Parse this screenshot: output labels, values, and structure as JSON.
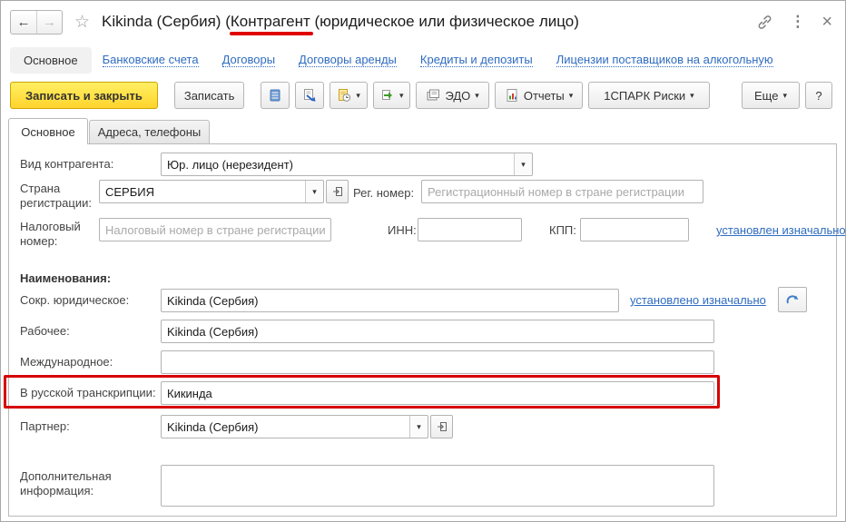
{
  "window": {
    "title_pre": "Kikinda (Сербия) (",
    "title_highlight": "Контрагент",
    "title_post": " (юридическое или физическое лицо)"
  },
  "icons": {
    "back": "←",
    "forward": "→",
    "star": "☆",
    "more_vert": "⋮",
    "close": "×",
    "caret": "▾",
    "help": "?"
  },
  "nav": {
    "active": "Основное",
    "links": [
      "Банковские счета",
      "Договоры",
      "Договоры аренды",
      "Кредиты и депозиты",
      "Лицензии поставщиков на алкогольную"
    ]
  },
  "toolbar": {
    "save_close": "Записать и закрыть",
    "save": "Записать",
    "edo": "ЭДО",
    "reports": "Отчеты",
    "spark": "1СПАРК Риски",
    "more": "Еще"
  },
  "tabs": {
    "main": "Основное",
    "addresses": "Адреса, телефоны"
  },
  "form": {
    "kind_label": "Вид контрагента:",
    "kind_value": "Юр. лицо (нерезидент)",
    "country_label": "Страна регистрации:",
    "country_value": "СЕРБИЯ",
    "regnum_label": "Рег. номер:",
    "regnum_placeholder": "Регистрационный номер в стране регистрации",
    "taxnum_label": "Налоговый номер:",
    "taxnum_placeholder": "Налоговый номер в стране регистрации",
    "inn_label": "ИНН:",
    "kpp_label": "КПП:",
    "inn_link": "установлен изначально",
    "names_header": "Наименования:",
    "short_label": "Сокр. юридическое:",
    "short_value": "Kikinda (Сербия)",
    "short_link": "установлено изначально",
    "working_label": "Рабочее:",
    "working_value": "Kikinda (Сербия)",
    "intl_label": "Международное:",
    "intl_value": "",
    "rus_label": "В русской транскрипции:",
    "rus_value": "Кикинда",
    "partner_label": "Партнер:",
    "partner_value": "Kikinda (Сербия)",
    "extra_label": "Дополнительная информация:",
    "extra_value": ""
  },
  "colors": {
    "accent_yellow": "#ffd935",
    "link_blue": "#2f6cc0",
    "annotation_red": "#d60000"
  }
}
